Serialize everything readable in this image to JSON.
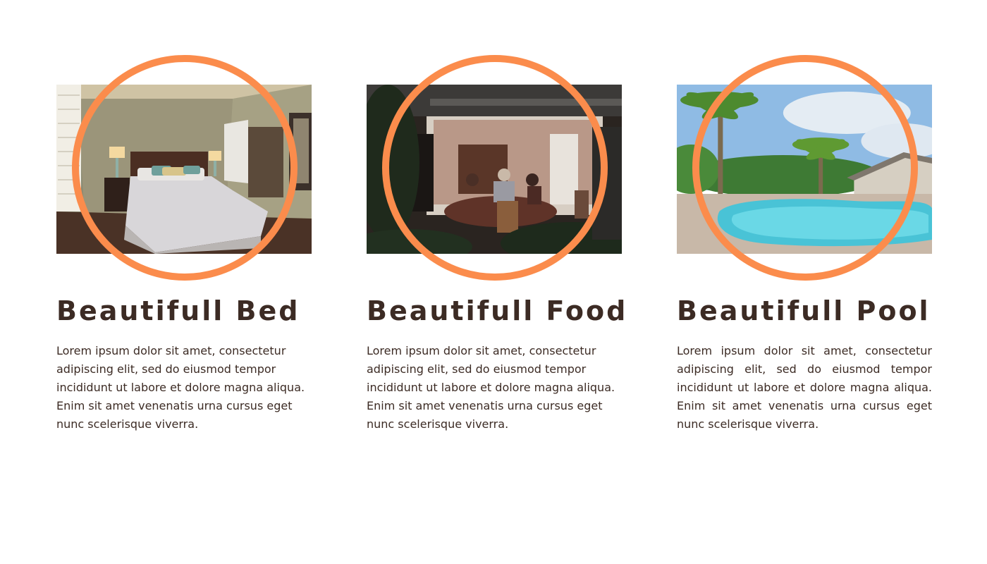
{
  "features": [
    {
      "title": "Beautifull Bed",
      "description": "Lorem ipsum dolor sit amet, consectetur adipiscing elit, sed do eiusmod tempor incididunt ut labore et dolore magna aliqua. Enim sit amet venenatis urna cursus eget nunc scelerisque viverra.",
      "image": "bedroom-photo"
    },
    {
      "title": "Beautifull Food",
      "description": "Lorem ipsum dolor sit amet, consectetur adipiscing elit, sed do eiusmod tempor incididunt ut labore et dolore magna aliqua. Enim sit amet venenatis urna cursus eget nunc scelerisque viverra.",
      "image": "dining-photo"
    },
    {
      "title": "Beautifull Pool",
      "description": "Lorem ipsum dolor sit amet, consectetur adipiscing elit, sed do eiusmod tempor incididunt ut labore et dolore magna aliqua. Enim sit amet venenatis urna cursus eget nunc scelerisque viverra.",
      "image": "pool-photo"
    }
  ],
  "colors": {
    "accent": "#fb8c4c",
    "text": "#3c2b24",
    "background": "#ffffff"
  }
}
